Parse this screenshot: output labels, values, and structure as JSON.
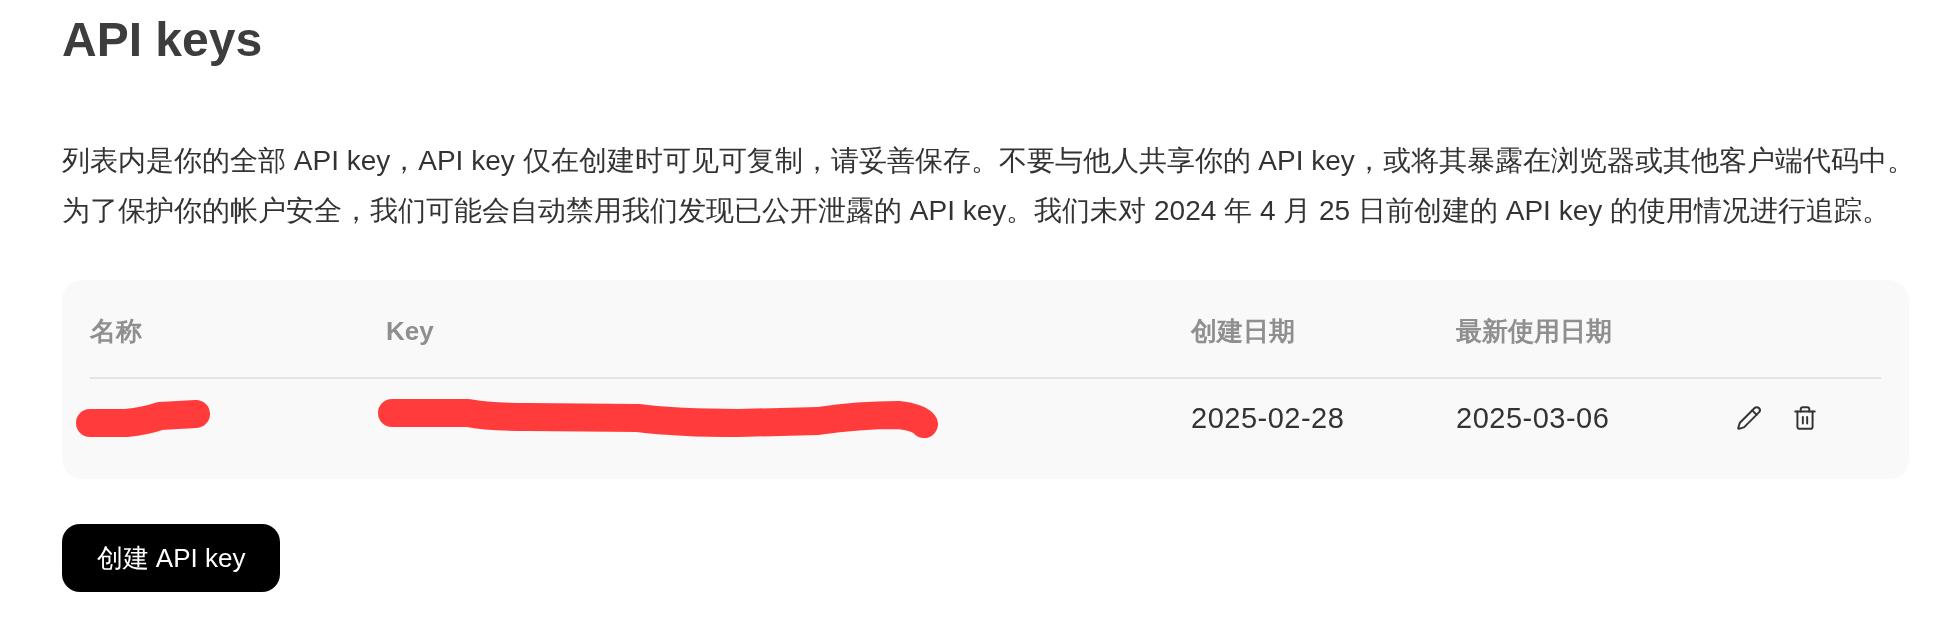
{
  "page": {
    "title": "API keys",
    "description": [
      "列表内是你的全部 API key，API key 仅在创建时可见可复制，请妥善保存。不要与他人共享你的 API key，或将其暴露在浏览器或其他客户端代码中。",
      "为了保护你的帐户安全，我们可能会自动禁用我们发现已公开泄露的 API key。我们未对 2024 年 4 月 25 日前创建的 API key 的使用情况进行追踪。"
    ]
  },
  "table": {
    "columns": [
      "名称",
      "Key",
      "创建日期",
      "最新使用日期"
    ],
    "rows": [
      {
        "name": {
          "redacted": true
        },
        "key": {
          "redacted": true
        },
        "created": "2025-02-28",
        "last_used": "2025-03-06"
      }
    ]
  },
  "create_button": {
    "label": "创建 API key"
  }
}
